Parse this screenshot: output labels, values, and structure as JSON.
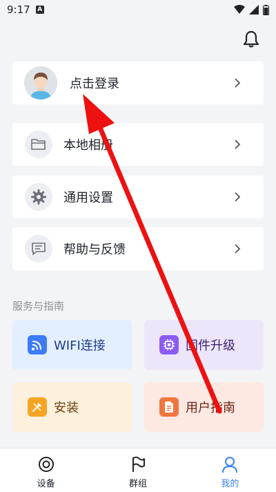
{
  "status_bar": {
    "time": "9:17",
    "app_icon_letter": "A"
  },
  "header": {
    "notification_icon": "bell-icon"
  },
  "login_card": {
    "label": "点击登录",
    "avatar_icon": "user-avatar"
  },
  "menu_items": [
    {
      "label": "本地相册",
      "icon": "folder-icon"
    },
    {
      "label": "通用设置",
      "icon": "gear-icon"
    },
    {
      "label": "帮助与反馈",
      "icon": "message-icon"
    }
  ],
  "services": {
    "title": "服务与指南",
    "tiles": [
      {
        "label": "WIFI连接",
        "icon": "wifi-icon",
        "bg": "#e3efff",
        "icon_color": "#3e7cf7",
        "text_color": "#1e3a8a"
      },
      {
        "label": "固件升级",
        "icon": "chip-icon",
        "bg": "#ede6fb",
        "icon_color": "#8b5cf6",
        "text_color": "#3b1f6e"
      },
      {
        "label": "安装",
        "icon": "tools-icon",
        "bg": "#fdf1de",
        "icon_color": "#f5a524",
        "text_color": "#6b3e06"
      },
      {
        "label": "用户指南",
        "icon": "document-icon",
        "bg": "#fde8e2",
        "icon_color": "#f0763f",
        "text_color": "#6b2410"
      }
    ]
  },
  "tabbar": {
    "tabs": [
      {
        "label": "设备",
        "icon": "device-icon",
        "active": false
      },
      {
        "label": "群组",
        "icon": "flag-icon",
        "active": false
      },
      {
        "label": "我的",
        "icon": "person-icon",
        "active": true
      }
    ],
    "active_color": "#3b82f6"
  },
  "annotation": {
    "arrow_color": "#ee1111"
  }
}
